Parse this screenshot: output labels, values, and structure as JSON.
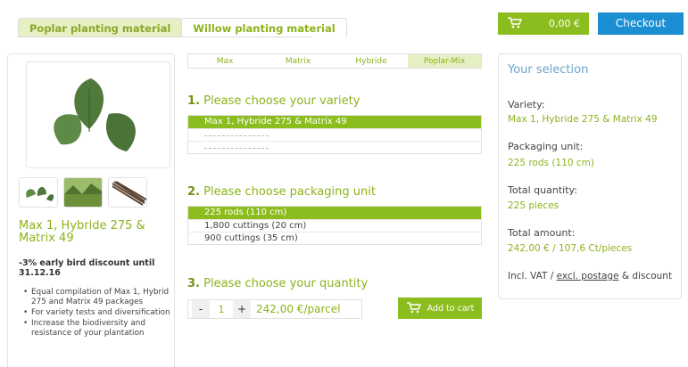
{
  "nav": {
    "tabs": [
      "Poplar planting material",
      "Willow planting material"
    ],
    "cart_amount": "0,00 €",
    "checkout_label": "Checkout"
  },
  "product": {
    "name": "Max 1, Hybride 275 & Matrix 49",
    "discount": "-3% early bird discount until 31.12.16",
    "features": [
      "Equal compilation of Max 1, Hybrid 275 and Matrix 49 packages",
      "For variety tests and diversification",
      "Increase the biodiversity and resistance of your plantation"
    ]
  },
  "variety_tabs": [
    "Max",
    "Matrix",
    "Hybride",
    "Poplar-Mix"
  ],
  "steps": {
    "step1_num": "1.",
    "step1_title": "Please choose your variety",
    "varieties": [
      "Max 1, Hybride 275 & Matrix 49"
    ],
    "step2_num": "2.",
    "step2_title": "Please choose packaging unit",
    "packaging": [
      "225 rods (110 cm)",
      "1,800 cuttings (20 cm)",
      "900 cuttings (35 cm)"
    ],
    "step3_num": "3.",
    "step3_title": "Please choose your quantity",
    "quantity": "1",
    "minus": "-",
    "plus": "+",
    "price": "242,00 €/parcel",
    "add_to_cart": "Add to cart"
  },
  "summary": {
    "title": "Your selection",
    "variety_label": "Variety:",
    "variety_value": "Max 1, Hybride 275 & Matrix 49",
    "packaging_label": "Packaging unit:",
    "packaging_value": "225 rods (110 cm)",
    "quantity_label": "Total quantity:",
    "quantity_value": "225 pieces",
    "amount_label": "Total amount:",
    "amount_value": "242,00 € / 107,6 Ct/pieces",
    "note_prefix": "Incl. VAT / ",
    "note_link": "excl. postage",
    "note_suffix": " & discount"
  },
  "colors": {
    "accent": "#8cbd1e",
    "checkout": "#1b8fd2",
    "summary_title": "#6aa4c9"
  },
  "icons": [
    "cart-icon",
    "leaf-icon"
  ]
}
